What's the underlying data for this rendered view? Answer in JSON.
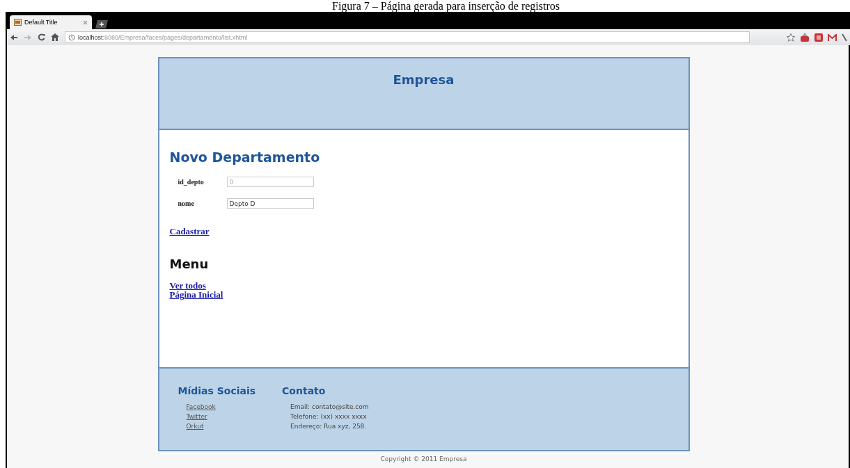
{
  "caption": "Figura 7 – Página gerada para inserção de registros",
  "browser": {
    "tab_title": "Default Title",
    "address_host": "localhost",
    "address_path": ":8080/Empresa/faces/pages/departamento/list.xhtml"
  },
  "header": {
    "title": "Empresa"
  },
  "form": {
    "title": "Novo Departamento",
    "fields": [
      {
        "label": "id_depto",
        "value": "0",
        "disabled": true
      },
      {
        "label": "nome",
        "value": "Depto D",
        "disabled": false
      }
    ],
    "submit": "Cadastrar"
  },
  "menu": {
    "title": "Menu",
    "links": [
      "Ver todos",
      "Página Inicial"
    ]
  },
  "footer": {
    "social": {
      "title": "Mídias Sociais",
      "links": [
        "Facebook",
        "Twitter",
        "Orkut"
      ]
    },
    "contact": {
      "title": "Contato",
      "lines": [
        "Email: contato@site.com",
        "Telefone: (xx) xxxx xxxx",
        "Endereço: Rua xyz, 258."
      ]
    }
  },
  "copyright": "Copyright © 2011 Empresa"
}
